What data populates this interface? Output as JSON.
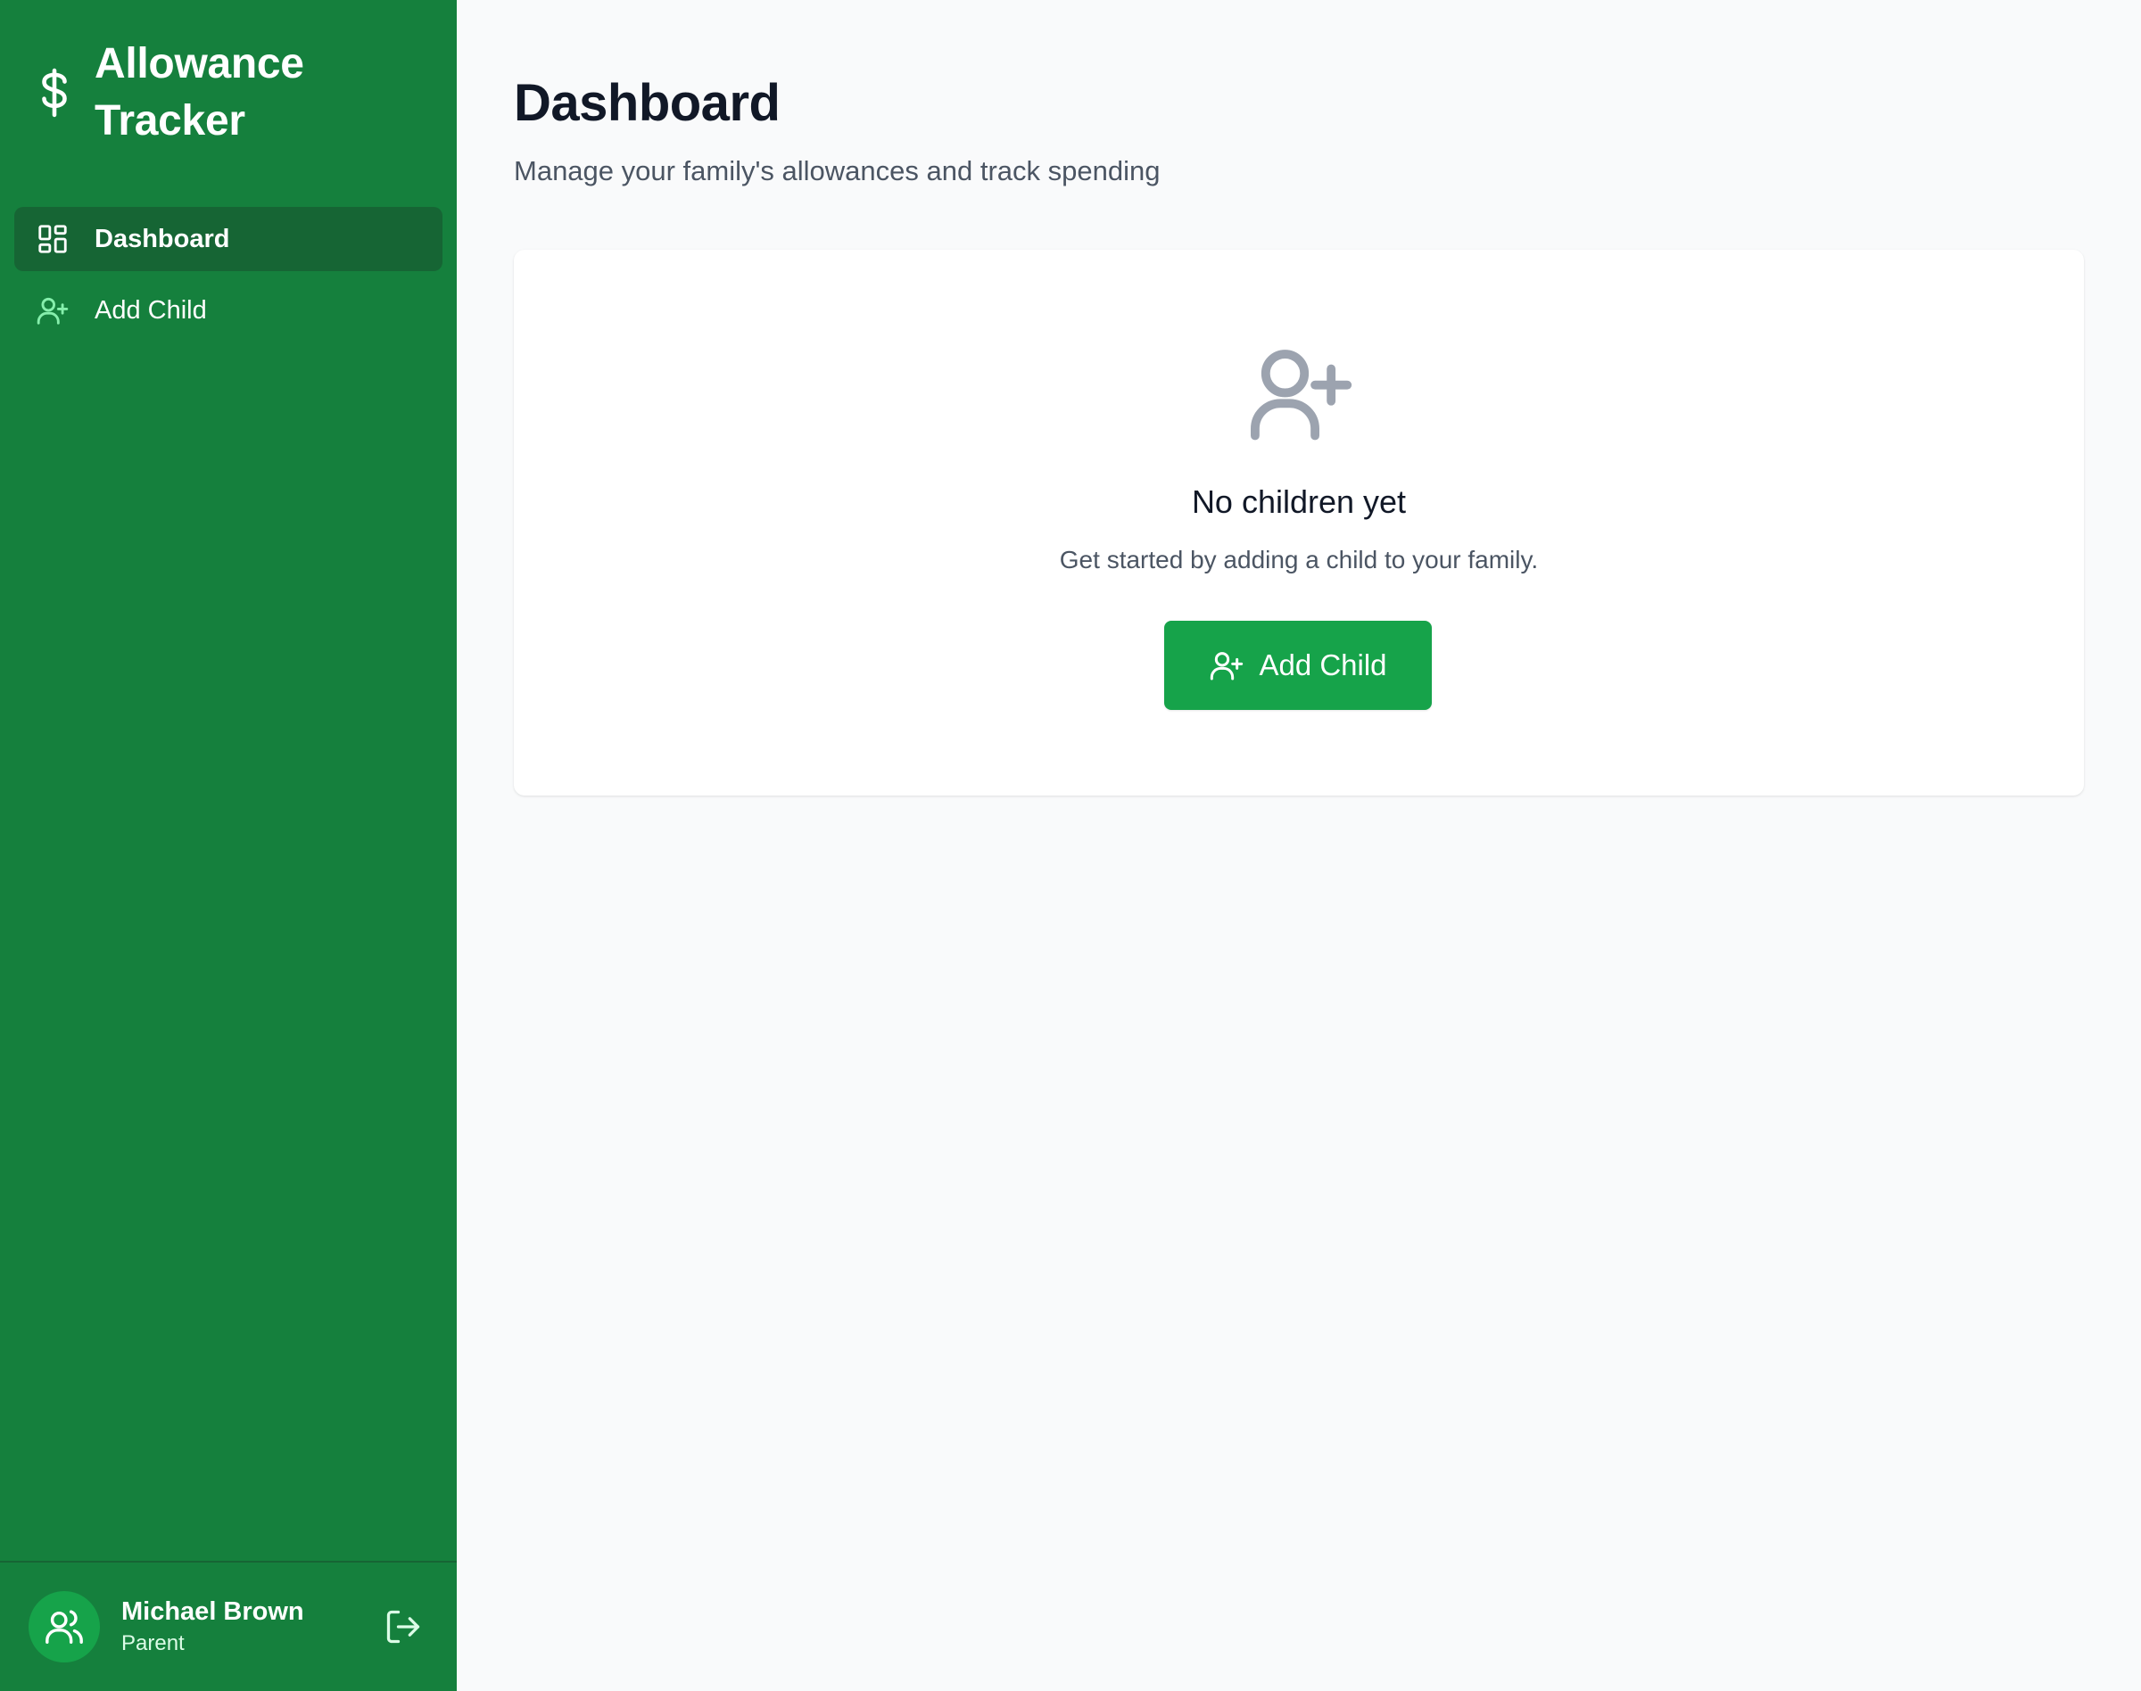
{
  "sidebar": {
    "brand": {
      "title_line1": "Allowance",
      "title_line2": "Tracker",
      "icon": "dollar-sign-icon"
    },
    "nav": [
      {
        "label": "Dashboard",
        "icon": "dashboard-icon",
        "active": true
      },
      {
        "label": "Add Child",
        "icon": "user-plus-icon",
        "active": false
      }
    ],
    "user": {
      "name": "Michael Brown",
      "role": "Parent",
      "avatar_icon": "users-icon",
      "logout_icon": "logout-icon"
    }
  },
  "main": {
    "title": "Dashboard",
    "subtitle": "Manage your family's allowances and track spending",
    "empty_state": {
      "icon": "user-plus-icon",
      "title": "No children yet",
      "text": "Get started by adding a child to your family.",
      "button_label": "Add Child"
    }
  },
  "colors": {
    "sidebar_bg": "#15803d",
    "sidebar_active": "#166534",
    "accent": "#16a34a",
    "page_bg": "#f9fafb",
    "icon_light_green": "#86efac",
    "empty_icon_gray": "#9ca3af"
  }
}
